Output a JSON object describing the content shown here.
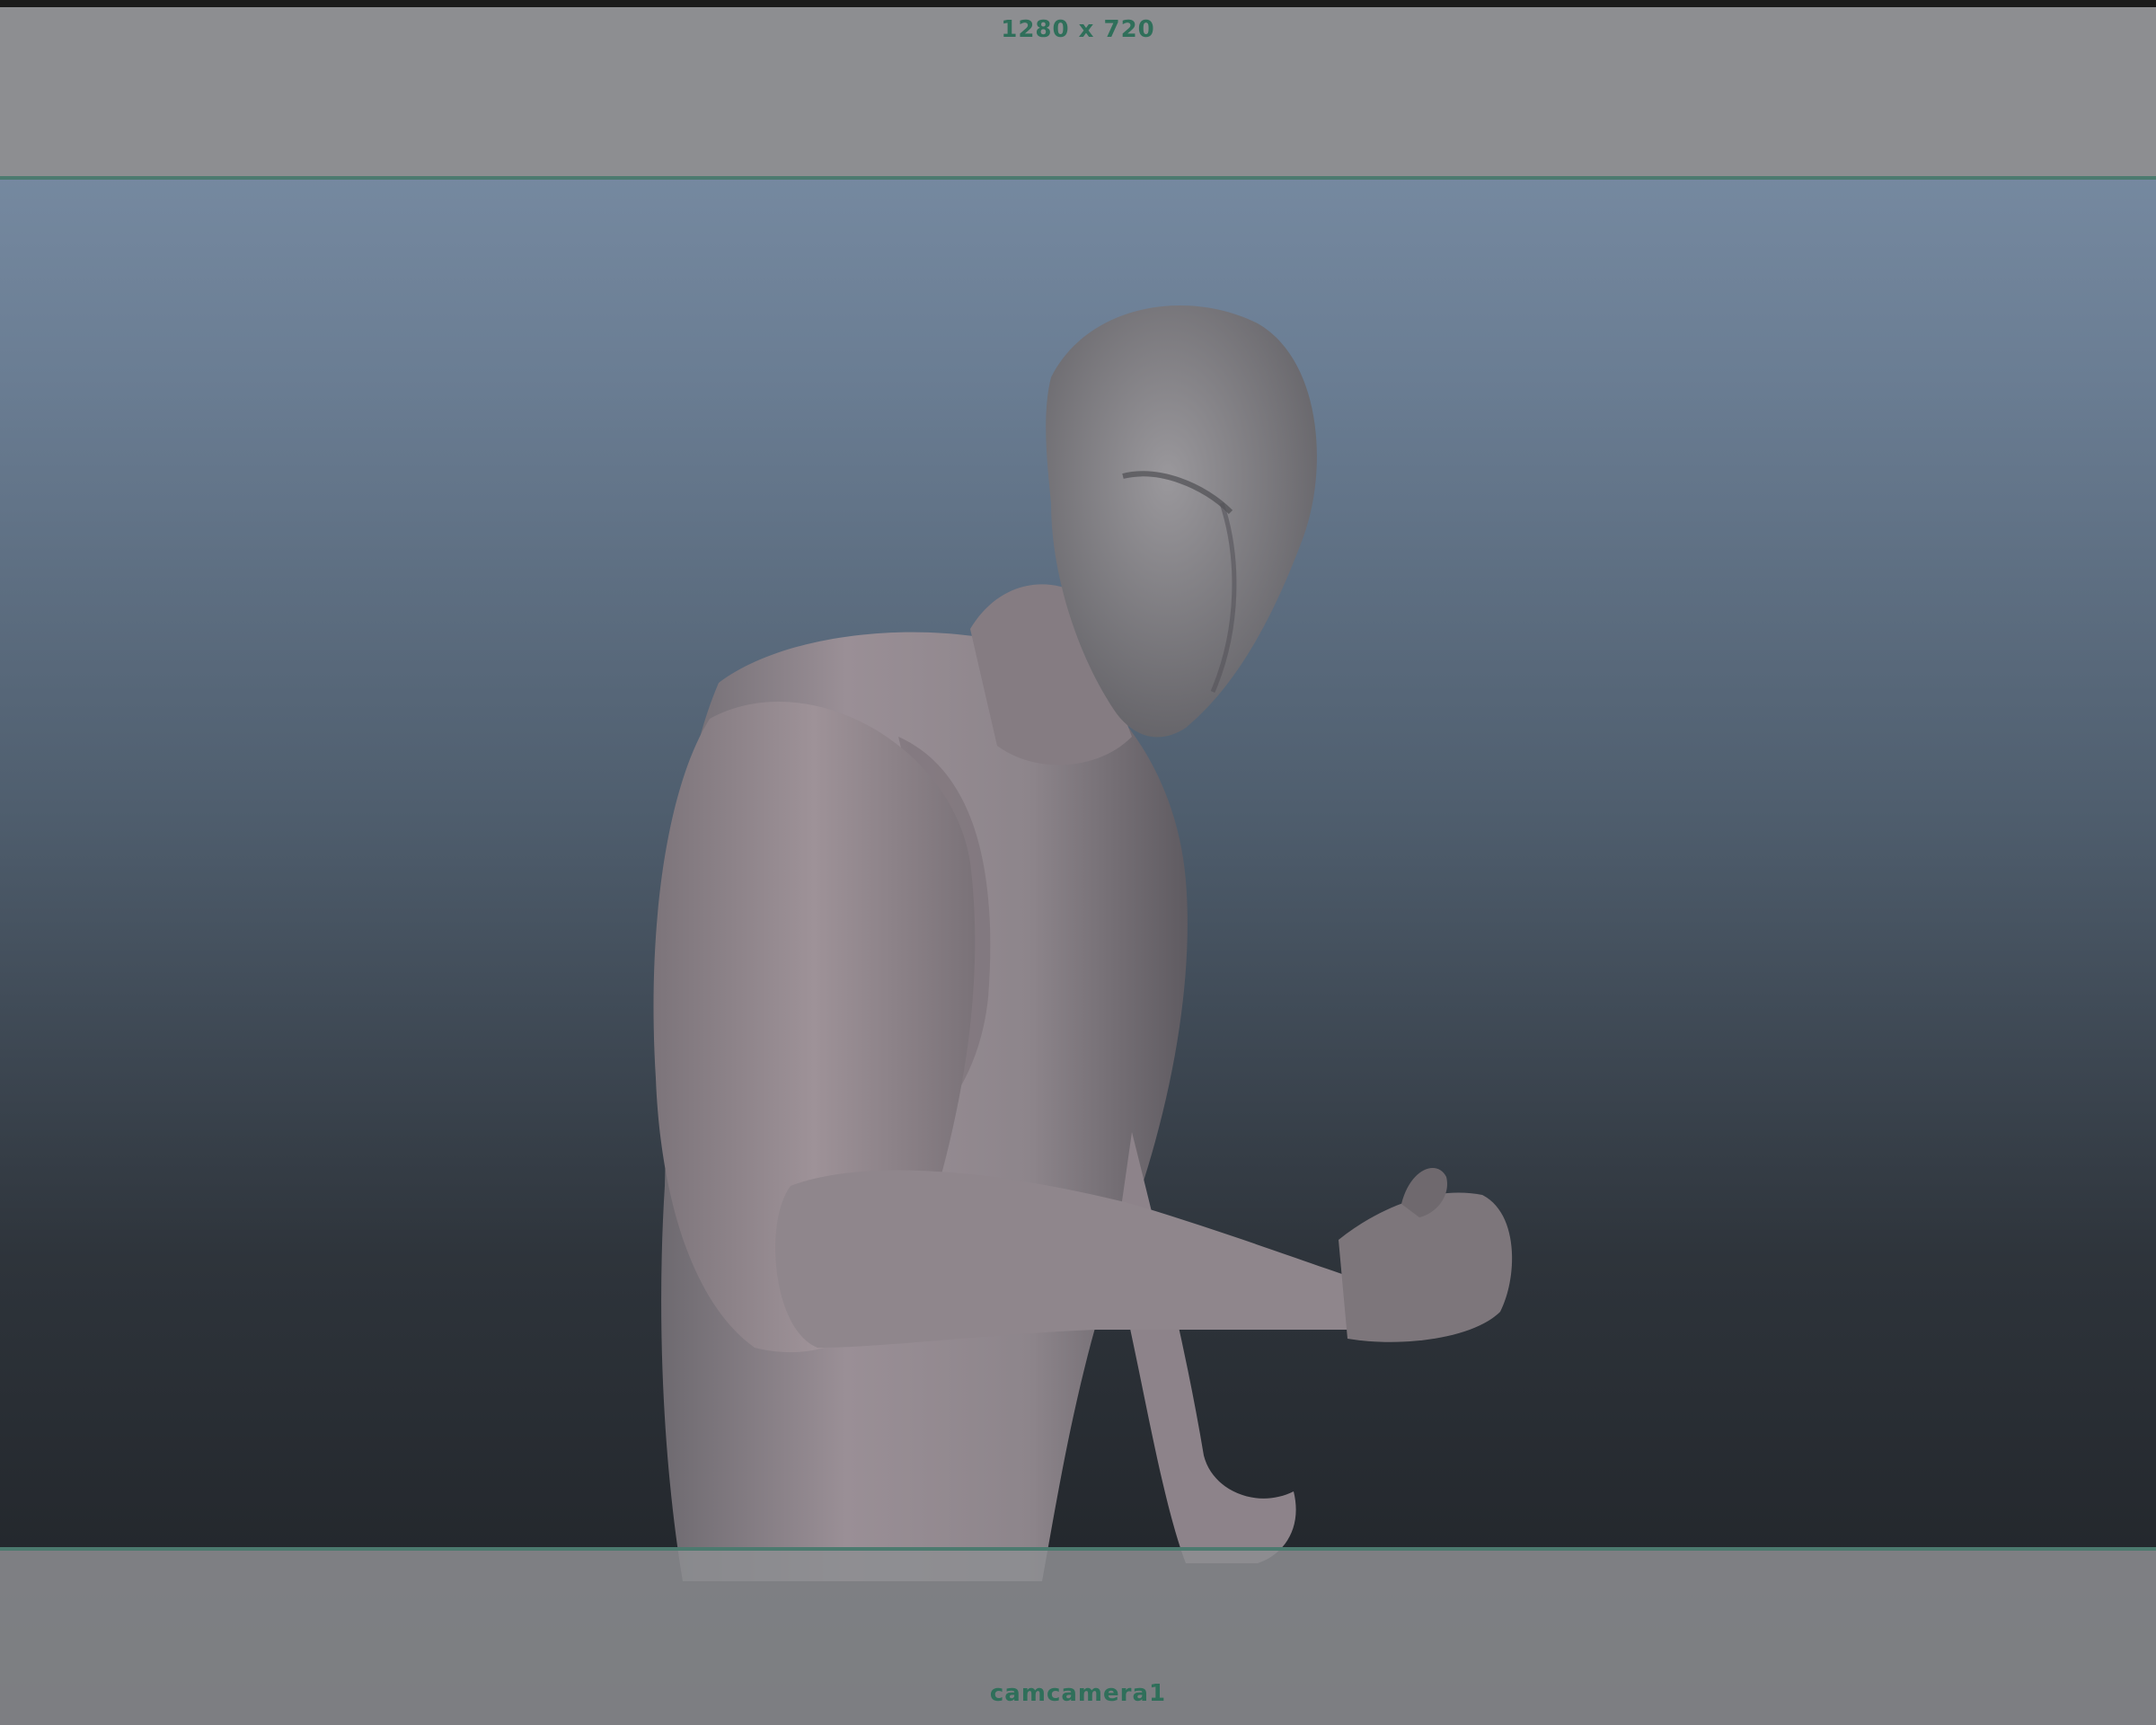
{
  "viewport": {
    "resolution_label": "1280 x 720",
    "camera_label": "camcamera1",
    "hud_color": "#2f6f5a",
    "gate_mask_color": "#8d8e91"
  },
  "scene": {
    "subject_icon": "humanoid-figure"
  }
}
